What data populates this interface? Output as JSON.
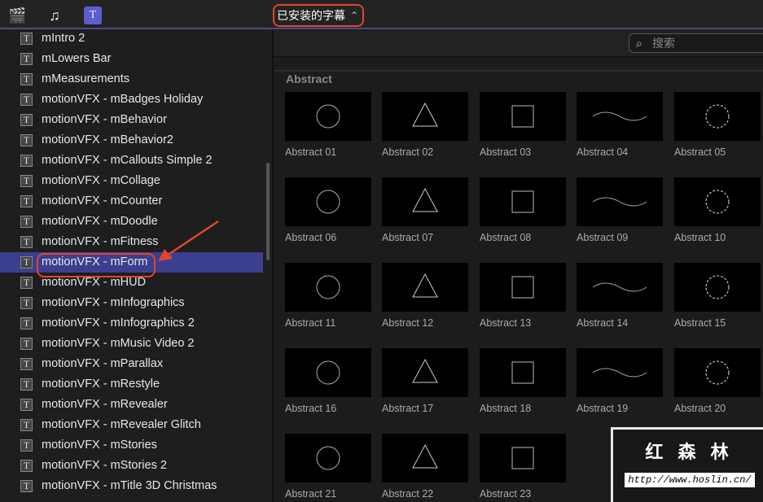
{
  "toolbar": {
    "icons": [
      "clapper-star-icon",
      "music-photo-icon",
      "titles-icon"
    ],
    "picker_label": "已安装的字幕",
    "search_placeholder": "搜索"
  },
  "sidebar": {
    "items": [
      "mIntro 2",
      "mLowers Bar",
      "mMeasurements",
      "motionVFX - mBadges Holiday",
      "motionVFX - mBehavior",
      "motionVFX - mBehavior2",
      "motionVFX - mCallouts Simple 2",
      "motionVFX - mCollage",
      "motionVFX - mCounter",
      "motionVFX - mDoodle",
      "motionVFX - mFitness",
      "motionVFX - mForm",
      "motionVFX - mHUD",
      "motionVFX - mInfographics",
      "motionVFX - mInfographics 2",
      "motionVFX - mMusic Video 2",
      "motionVFX - mParallax",
      "motionVFX - mRestyle",
      "motionVFX - mRevealer",
      "motionVFX - mRevealer Glitch",
      "motionVFX - mStories",
      "motionVFX - mStories 2",
      "motionVFX - mTitle 3D Christmas"
    ],
    "selected": "motionVFX - mForm"
  },
  "main": {
    "section": "Abstract",
    "items": [
      "Abstract 01",
      "Abstract 02",
      "Abstract 03",
      "Abstract 04",
      "Abstract 05",
      "Abstract 06",
      "Abstract 07",
      "Abstract 08",
      "Abstract 09",
      "Abstract 10",
      "Abstract 11",
      "Abstract 12",
      "Abstract 13",
      "Abstract 14",
      "Abstract 15",
      "Abstract 16",
      "Abstract 17",
      "Abstract 18",
      "Abstract 19",
      "Abstract 20",
      "Abstract 21",
      "Abstract 22",
      "Abstract 23"
    ]
  },
  "watermark": {
    "title": "红森林",
    "url": "http://www.hoslin.cn/"
  },
  "colors": {
    "accent": "#3b3f8e",
    "highlight": "#e0452a"
  }
}
